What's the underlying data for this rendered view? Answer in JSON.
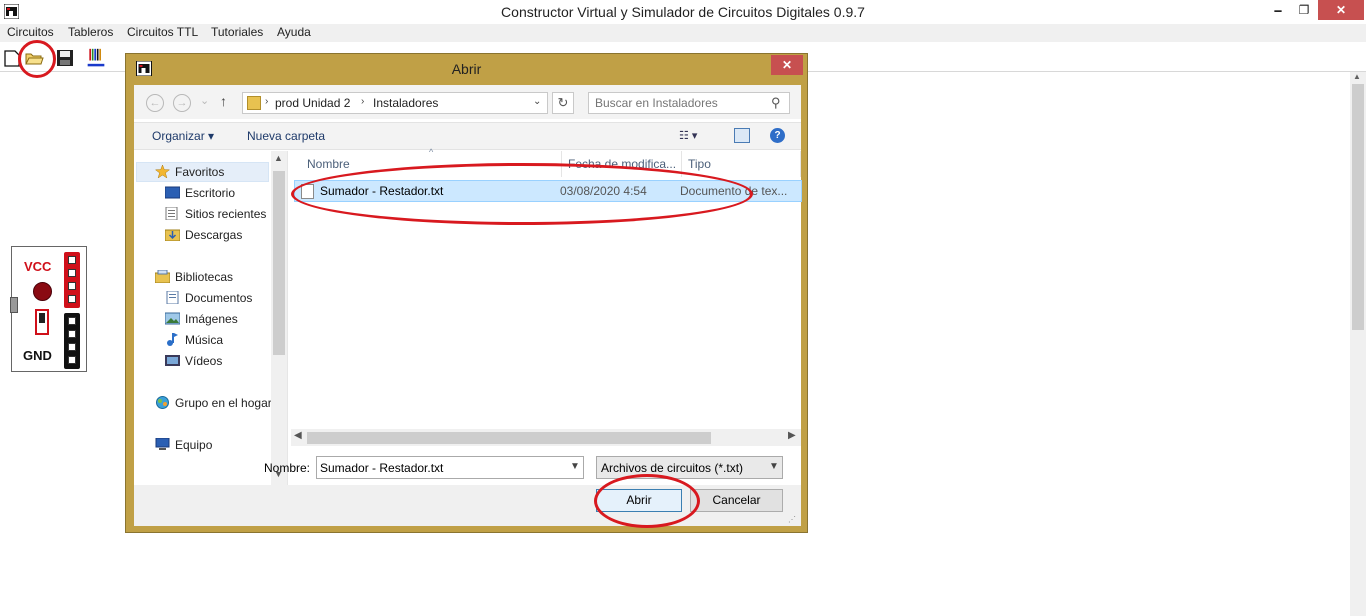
{
  "window": {
    "title": "Constructor Virtual y Simulador de Circuitos Digitales 0.9.7",
    "minimize_glyph": "🗕",
    "maximize_glyph": "❐",
    "close_glyph": "✕"
  },
  "menu": {
    "items": [
      {
        "label": "Circuitos"
      },
      {
        "label": "Tableros"
      },
      {
        "label": "Circuitos TTL"
      },
      {
        "label": "Tutoriales"
      },
      {
        "label": "Ayuda"
      }
    ]
  },
  "toolbar": {
    "icons": [
      "new-file-icon",
      "open-folder-icon",
      "save-disk-icon",
      "wires-icon"
    ]
  },
  "power_module": {
    "vcc_label": "VCC",
    "gnd_label": "GND"
  },
  "dialog": {
    "title": "Abrir",
    "close_glyph": "✕",
    "nav": {
      "back": "←",
      "forward": "→",
      "recent": "⌄",
      "up": "↑"
    },
    "breadcrumb": [
      "prod Unidad 2",
      "Instaladores"
    ],
    "breadcrumb_sep": "›",
    "refresh_glyph": "↻",
    "search_placeholder": "Buscar en Instaladores",
    "search_glyph": "⚲",
    "commands": {
      "organize": "Organizar ▾",
      "new_folder": "Nueva carpeta",
      "view_glyph": "☷ ▾",
      "help_glyph": "?"
    },
    "sidebar": {
      "favorites": "Favoritos",
      "favorites_items": [
        "Escritorio",
        "Sitios recientes",
        "Descargas"
      ],
      "libraries": "Bibliotecas",
      "libraries_items": [
        "Documentos",
        "Imágenes",
        "Música",
        "Vídeos"
      ],
      "homegroup": "Grupo en el hogar",
      "computer": "Equipo"
    },
    "columns": {
      "name": "Nombre",
      "date": "Fecha de modifica...",
      "type": "Tipo"
    },
    "files": [
      {
        "name": "Sumador - Restador.txt",
        "date": "03/08/2020 4:54",
        "type": "Documento de tex..."
      }
    ],
    "footer": {
      "name_label": "Nombre:",
      "name_value": "Sumador - Restador.txt",
      "filter_value": "Archivos de circuitos (*.txt)",
      "open_label": "Abrir",
      "cancel_label": "Cancelar"
    }
  },
  "colors": {
    "dialog_frame": "#c0a046",
    "annotation_red": "#d8191f",
    "selection": "#cce8ff",
    "close_red": "#c75050"
  }
}
